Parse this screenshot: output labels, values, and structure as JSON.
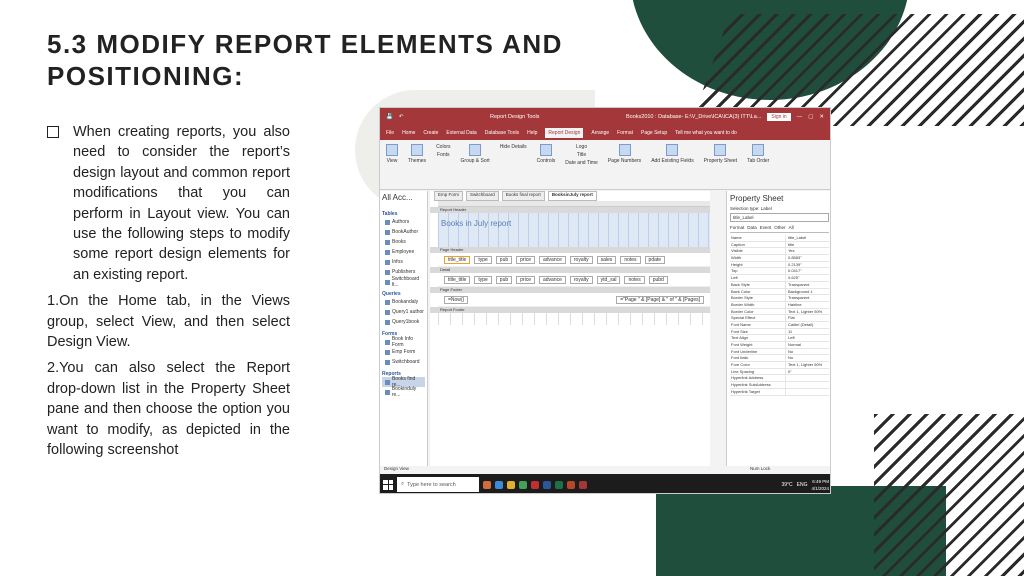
{
  "slide": {
    "title_line1": "5.3 MODIFY REPORT ELEMENTS AND",
    "title_line2": "POSITIONING:",
    "bullet_text": "When creating reports, you also need to consider the report’s design layout and common report modifications that you can perform in Layout view. You can use the following steps to modify some report design elements for an existing report.",
    "step1": "1.On the Home tab, in the Views group, select View, and then select Design View.",
    "step2": "2.You can also select the Report drop-down list in the Property Sheet pane and then choose the option you want to modify, as depicted in the following screenshot"
  },
  "colors": {
    "accent_green": "#1f4e3d",
    "access_red": "#a4373a"
  },
  "screenshot": {
    "window_title": "Books2010 : Database- E:\\V_Drive\\ICA\\ICA(3) ITT\\La...",
    "tools_label": "Report Design Tools",
    "signin": "Sign in",
    "menu": [
      "File",
      "Home",
      "Create",
      "External Data",
      "Database Tools",
      "Help",
      "Report Design",
      "Arrange",
      "Format",
      "Page Setup",
      "Tell me what you want to do"
    ],
    "ribbon": [
      "View",
      "Themes",
      "Colors",
      "Fonts",
      "Group & Sort",
      "Hide Details",
      "Controls",
      "Logo",
      "Title",
      "Date and Time",
      "Page Numbers",
      "Add Existing Fields",
      "Property Sheet",
      "Tab Order"
    ],
    "nav_header": "All Acc...",
    "nav": {
      "tables_label": "Tables",
      "tables": [
        "Authors",
        "BookAuthor",
        "Books",
        "Employee",
        "Infos",
        "Publishers",
        "Switchboard It..."
      ],
      "queries_label": "Queries",
      "queries": [
        "Bookandaly",
        "Query1 author",
        "Query1book"
      ],
      "forms_label": "Forms",
      "forms": [
        "Book Info Form",
        "Emp Form",
        "Switchboard"
      ],
      "reports_label": "Reports",
      "reports": [
        "Books find re...",
        "Bookinduly re..."
      ]
    },
    "doc_tabs": [
      "Emp Form",
      "Switchboard",
      "Books final report",
      "BooksinJuly report"
    ],
    "sections": {
      "report_header": "Report Header",
      "page_header": "Page Header",
      "detail": "Detail",
      "page_footer": "Page Footer",
      "report_footer": "Report Footer"
    },
    "report_title": "Books in July report",
    "header_fields": [
      "title_title",
      "type",
      "pub",
      "price",
      "advance",
      "royalty",
      "sales",
      "notes",
      "pdate"
    ],
    "detail_fields": [
      "title_title",
      "type",
      "pub",
      "price",
      "advance",
      "royalty",
      "ytd_sal",
      "notes",
      "pubd"
    ],
    "footer_left": "=Now()",
    "footer_right": "=\"Page \" & [Page] & \" of \" & [Pages]",
    "property_sheet": {
      "title": "Property Sheet",
      "selection_type": "Selection type: Label",
      "combo": "title_Label",
      "tabs": [
        "Format",
        "Data",
        "Event",
        "Other",
        "All"
      ],
      "rows": [
        [
          "Name",
          "title_Label"
        ],
        [
          "Caption",
          "title"
        ],
        [
          "Visible",
          "Yes"
        ],
        [
          "Width",
          "0.8583\""
        ],
        [
          "Height",
          "0.2139\""
        ],
        [
          "Top",
          "0.0417\""
        ],
        [
          "Left",
          "0.625\""
        ],
        [
          "Back Style",
          "Transparent"
        ],
        [
          "Back Color",
          "Background 1"
        ],
        [
          "Border Style",
          "Transparent"
        ],
        [
          "Border Width",
          "Hairline"
        ],
        [
          "Border Color",
          "Text 1, Lighter 50%"
        ],
        [
          "Special Effect",
          "Flat"
        ],
        [
          "Font Name",
          "Calibri (Detail)"
        ],
        [
          "Font Size",
          "11"
        ],
        [
          "Text Align",
          "Left"
        ],
        [
          "Font Weight",
          "Normal"
        ],
        [
          "Font Underline",
          "No"
        ],
        [
          "Font Italic",
          "No"
        ],
        [
          "Fore Color",
          "Text 1, Lighter 50%"
        ],
        [
          "Line Spacing",
          "0\""
        ],
        [
          "Hyperlink Address",
          ""
        ],
        [
          "Hyperlink SubAddress",
          ""
        ],
        [
          "Hyperlink Target",
          ""
        ]
      ]
    },
    "status_left": "Design View",
    "status_right": "Num Lock",
    "taskbar": {
      "search_placeholder": "Type here to search",
      "weather": "39°C",
      "lang": "ENG",
      "time": "6:49 PM",
      "date": "4/1/2024"
    }
  }
}
